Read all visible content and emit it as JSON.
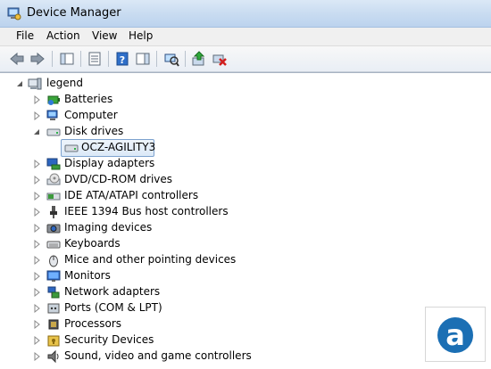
{
  "window": {
    "title": "Device Manager"
  },
  "menu": {
    "items": [
      "File",
      "Action",
      "View",
      "Help"
    ]
  },
  "tree": {
    "root": "legend",
    "categories": [
      {
        "label": "Batteries",
        "icon": "battery-icon",
        "expanded": false
      },
      {
        "label": "Computer",
        "icon": "computer-icon",
        "expanded": false
      },
      {
        "label": "Disk drives",
        "icon": "disk-drive-icon",
        "expanded": true,
        "children": [
          {
            "label": "OCZ-AGILITY3",
            "selected": true
          }
        ]
      },
      {
        "label": "Display adapters",
        "icon": "display-adapter-icon",
        "expanded": false
      },
      {
        "label": "DVD/CD-ROM drives",
        "icon": "dvd-drive-icon",
        "expanded": false
      },
      {
        "label": "IDE ATA/ATAPI controllers",
        "icon": "ide-controller-icon",
        "expanded": false
      },
      {
        "label": "IEEE 1394 Bus host controllers",
        "icon": "firewire-icon",
        "expanded": false
      },
      {
        "label": "Imaging devices",
        "icon": "camera-icon",
        "expanded": false
      },
      {
        "label": "Keyboards",
        "icon": "keyboard-icon",
        "expanded": false
      },
      {
        "label": "Mice and other pointing devices",
        "icon": "mouse-icon",
        "expanded": false
      },
      {
        "label": "Monitors",
        "icon": "monitor-icon",
        "expanded": false
      },
      {
        "label": "Network adapters",
        "icon": "network-icon",
        "expanded": false
      },
      {
        "label": "Ports (COM & LPT)",
        "icon": "port-icon",
        "expanded": false
      },
      {
        "label": "Processors",
        "icon": "processor-icon",
        "expanded": false
      },
      {
        "label": "Security Devices",
        "icon": "security-icon",
        "expanded": false
      },
      {
        "label": "Sound, video and game controllers",
        "icon": "sound-icon",
        "expanded": false
      }
    ]
  },
  "colors": {
    "accent": "#1c5aa6",
    "selection_border": "#7da2ce"
  }
}
